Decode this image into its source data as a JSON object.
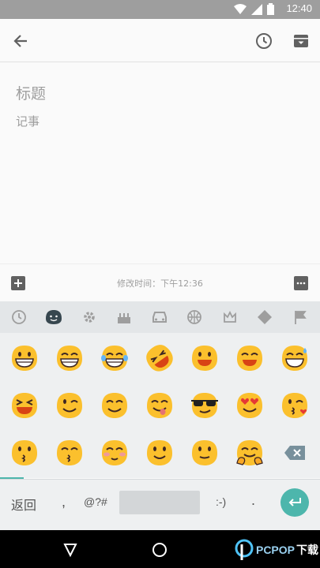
{
  "status_bar": {
    "time": "12:40"
  },
  "note": {
    "title_placeholder": "标题",
    "body_placeholder": "记事"
  },
  "bottom_bar": {
    "edited_text": "修改时间：下午12:36"
  },
  "emoji_tabs": [
    "recent-icon",
    "smiley-icon",
    "settings-icon",
    "cake-icon",
    "car-icon",
    "ball-icon",
    "crown-icon",
    "diamond-icon",
    "flag-icon"
  ],
  "emoji_grid": [
    [
      "grin-icon",
      "beaming-icon",
      "laughing-tears-icon",
      "rolling-laugh-icon",
      "smile-icon",
      "smiling-eyes-icon",
      "sweat-smile-icon"
    ],
    [
      "squint-laugh-icon",
      "wink-icon",
      "content-smile-icon",
      "yum-icon",
      "sunglasses-icon",
      "heart-eyes-icon",
      "kiss-heart-icon"
    ],
    [
      "kissing-icon",
      "kissing-closed-icon",
      "blush-icon",
      "slight-smile-icon",
      "neutral-smile-icon",
      "hugging-icon",
      "backspace-icon"
    ]
  ],
  "keyboard": {
    "back_label": "返回",
    "comma_label": ",",
    "symbols_label": "@?#",
    "emoticon_label": ":-)",
    "period_label": "."
  },
  "watermark": {
    "text": "PCPOP",
    "suffix": "下载"
  },
  "colors": {
    "accent": "#4db6ac",
    "emoji_yellow": "#fbc02d",
    "status_bar": "#9e9e9e"
  }
}
